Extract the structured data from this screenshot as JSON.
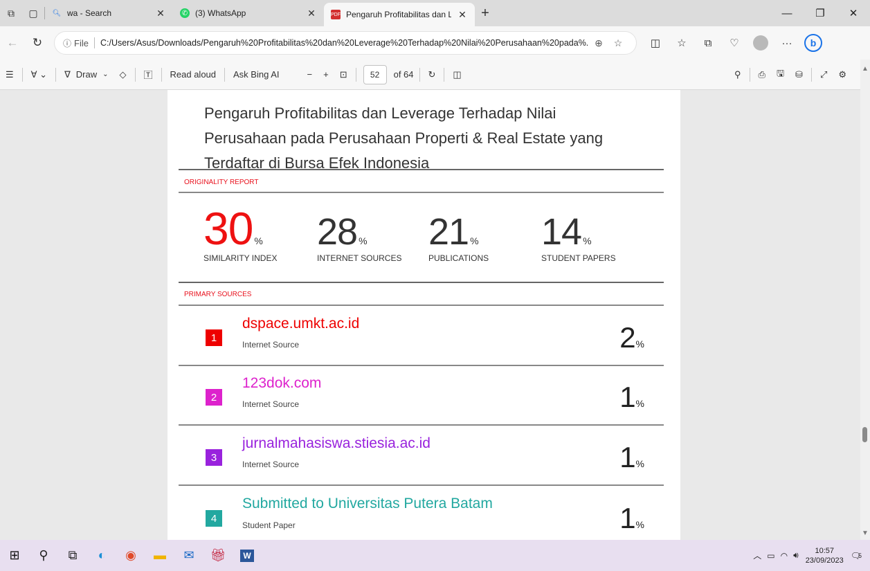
{
  "browser": {
    "tabs": [
      {
        "title": "wa - Search",
        "active": false
      },
      {
        "title": "(3) WhatsApp",
        "active": false
      },
      {
        "title": "Pengaruh Profitabilitas dan Lever",
        "active": true
      }
    ],
    "new_tab": "+",
    "url_prefix": "File",
    "url": "C:/Users/Asus/Downloads/Pengaruh%20Profitabilitas%20dan%20Leverage%20Terhadap%20Nilai%20Perusahaan%20pada%..."
  },
  "pdf_toolbar": {
    "draw_label": "Draw",
    "read_aloud": "Read aloud",
    "ask_bing": "Ask Bing AI",
    "page_current": "52",
    "page_total": "of 64"
  },
  "document": {
    "title": "Pengaruh Profitabilitas dan Leverage Terhadap Nilai Perusahaan pada Perusahaan Properti & Real Estate yang Terdaftar di Bursa Efek Indonesia",
    "originality_label": "ORIGINALITY REPORT",
    "stats": [
      {
        "value": "30",
        "unit": "%",
        "label": "SIMILARITY INDEX"
      },
      {
        "value": "28",
        "unit": "%",
        "label": "INTERNET SOURCES"
      },
      {
        "value": "21",
        "unit": "%",
        "label": "PUBLICATIONS"
      },
      {
        "value": "14",
        "unit": "%",
        "label": "STUDENT PAPERS"
      }
    ],
    "primary_label": "PRIMARY SOURCES",
    "sources": [
      {
        "rank": "1",
        "name": "dspace.umkt.ac.id",
        "type": "Internet Source",
        "pct": "2",
        "unit": "%",
        "color": "#ee0000"
      },
      {
        "rank": "2",
        "name": "123dok.com",
        "type": "Internet Source",
        "pct": "1",
        "unit": "%",
        "color": "#dd22cc"
      },
      {
        "rank": "3",
        "name": "jurnalmahasiswa.stiesia.ac.id",
        "type": "Internet Source",
        "pct": "1",
        "unit": "%",
        "color": "#9922dd"
      },
      {
        "rank": "4",
        "name": "Submitted to Universitas Putera Batam",
        "type": "Student Paper",
        "pct": "1",
        "unit": "%",
        "color": "#22a8a0"
      }
    ]
  },
  "taskbar": {
    "time": "10:57",
    "date": "23/09/2023",
    "notification_count": "5"
  }
}
